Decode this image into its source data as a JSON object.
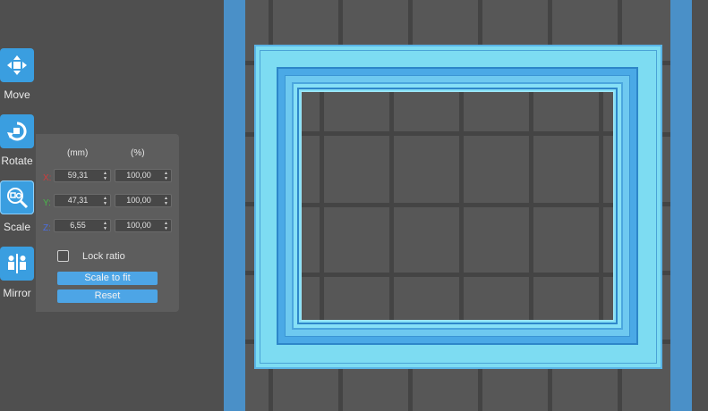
{
  "toolbar": {
    "move_label": "Move",
    "rotate_label": "Rotate",
    "scale_label": "Scale",
    "mirror_label": "Mirror"
  },
  "scale_panel": {
    "mm_header": "(mm)",
    "percent_header": "(%)",
    "x": {
      "label": "X:",
      "mm": "59,31",
      "percent": "100,00",
      "color": "#d23c3c"
    },
    "y": {
      "label": "Y:",
      "mm": "47,31",
      "percent": "100,00",
      "color": "#48b948"
    },
    "z": {
      "label": "Z:",
      "mm": "6,55",
      "percent": "100,00",
      "color": "#4c6ee0"
    },
    "lock_ratio_label": "Lock ratio",
    "lock_ratio_checked": false,
    "scale_to_fit_label": "Scale to fit",
    "reset_label": "Reset"
  },
  "colors": {
    "accent": "#3a9ee0",
    "model": "#7ddcf2",
    "bed_edge": "#4a90c8"
  },
  "icons": {
    "move": "move-arrows-icon",
    "rotate": "rotate-icon",
    "scale": "scale-magnifier-icon",
    "mirror": "mirror-icon"
  }
}
